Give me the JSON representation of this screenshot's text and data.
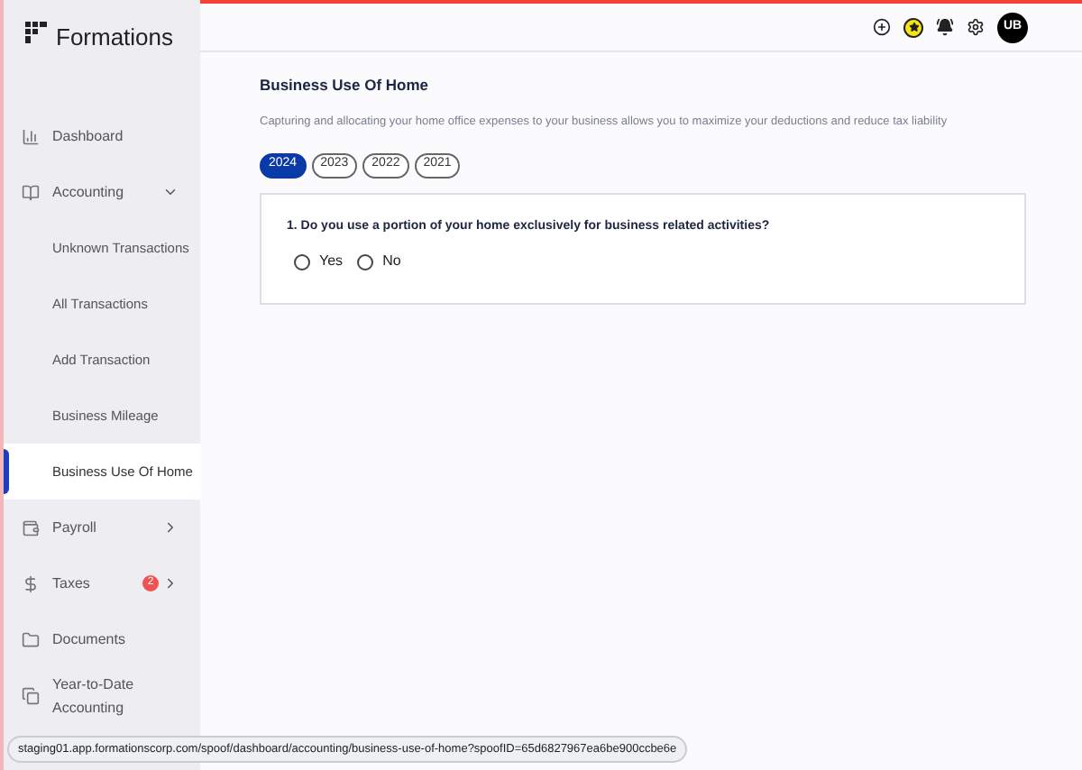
{
  "logo": {
    "text": "Formations"
  },
  "sidebar": {
    "items": [
      {
        "label": "Dashboard",
        "selected": false
      },
      {
        "label": "Accounting",
        "selected": false,
        "expanded": true,
        "children": [
          {
            "label": "Unknown Transactions",
            "selected": false
          },
          {
            "label": "All Transactions",
            "selected": false
          },
          {
            "label": "Add Transaction",
            "selected": false
          },
          {
            "label": "Business Mileage",
            "selected": false
          },
          {
            "label": "Business Use Of Home",
            "selected": true
          }
        ]
      },
      {
        "label": "Payroll",
        "selected": false,
        "expanded": false
      },
      {
        "label": "Taxes",
        "selected": false,
        "expanded": false,
        "badge": "2"
      },
      {
        "label": "Documents",
        "selected": false
      },
      {
        "label": "Year-to-Date Accounting",
        "selected": false
      }
    ]
  },
  "header": {
    "avatar": "UB"
  },
  "page": {
    "title": "Business Use Of Home",
    "description": "Capturing and allocating your home office expenses to your business allows you to maximize your deductions and reduce tax liability",
    "years": [
      {
        "label": "2024",
        "selected": true
      },
      {
        "label": "2023",
        "selected": false
      },
      {
        "label": "2022",
        "selected": false
      },
      {
        "label": "2021",
        "selected": false
      }
    ],
    "question": {
      "text": "1. Do you use a portion of your home exclusively for business related activities?",
      "options": [
        {
          "label": "Yes",
          "selected": false
        },
        {
          "label": "No",
          "selected": false
        }
      ]
    }
  },
  "status_bar": {
    "url": "staging01.app.formationscorp.com/spoof/dashboard/accounting/business-use-of-home?spoofID=65d6827967ea6be900ccbe6e"
  }
}
